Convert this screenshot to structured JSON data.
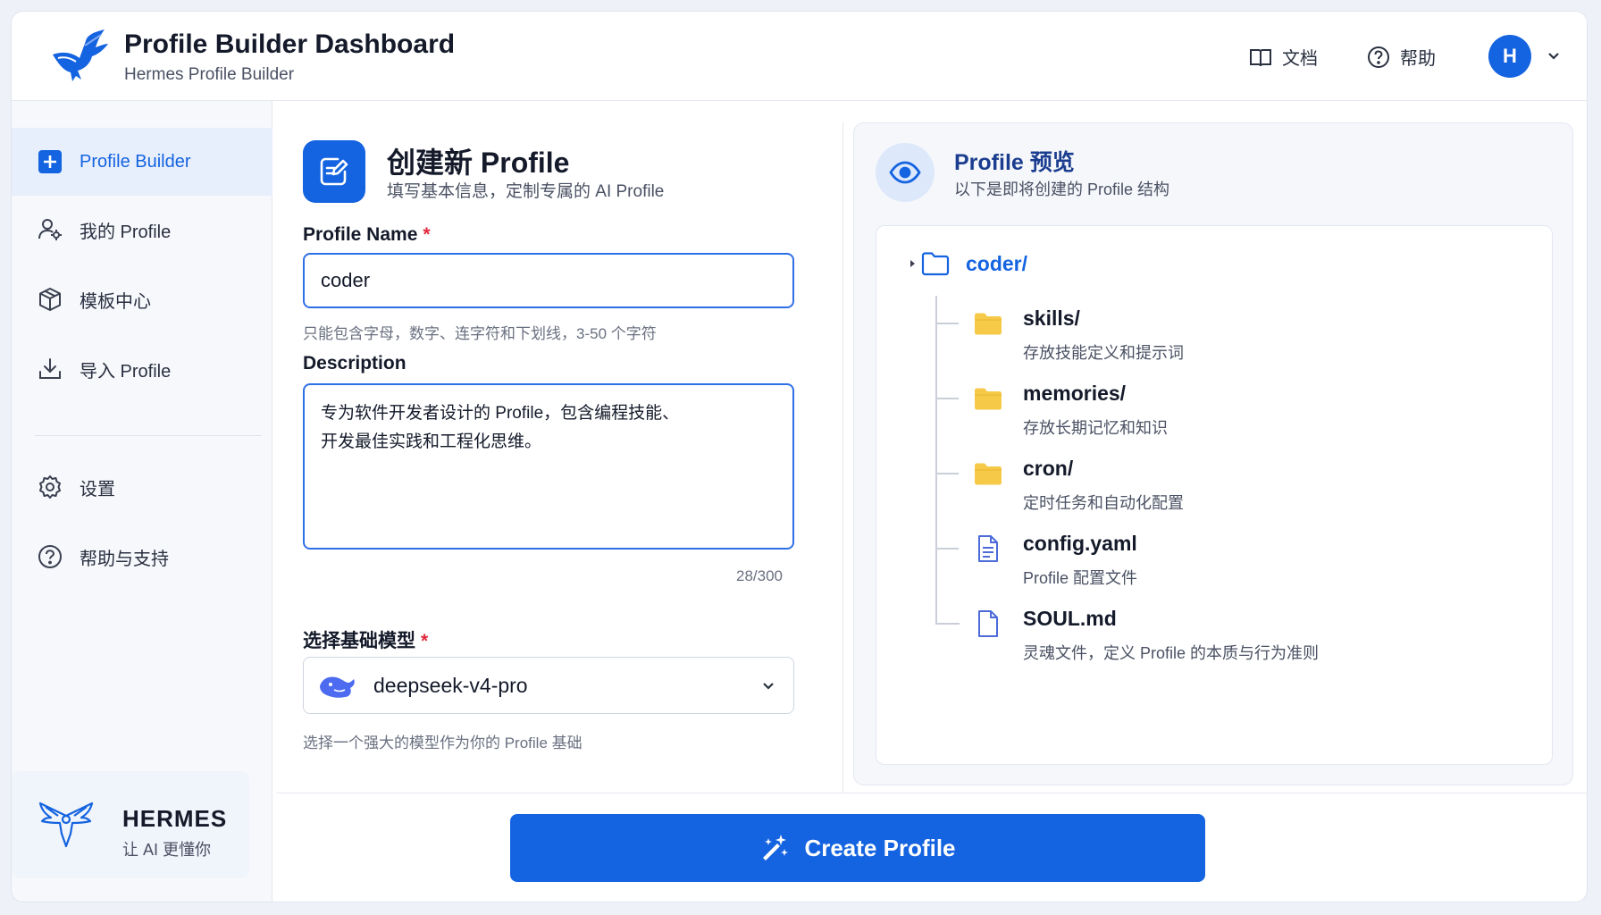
{
  "header": {
    "title": "Profile Builder Dashboard",
    "subtitle": "Hermes Profile Builder",
    "docs_label": "文档",
    "help_label": "帮助",
    "avatar_initial": "H"
  },
  "sidebar": {
    "items": [
      {
        "label": "Profile Builder",
        "icon": "plus-square-icon",
        "active": true
      },
      {
        "label": "我的 Profile",
        "icon": "users-icon"
      },
      {
        "label": "模板中心",
        "icon": "cube-icon"
      },
      {
        "label": "导入 Profile",
        "icon": "import-icon"
      },
      {
        "label": "设置",
        "icon": "gear-icon"
      },
      {
        "label": "帮助与支持",
        "icon": "help-circle-icon"
      }
    ],
    "brand": {
      "name": "HERMES",
      "tagline": "让 AI 更懂你"
    }
  },
  "form": {
    "title": "创建新 Profile",
    "subtitle": "填写基本信息，定制专属的 AI Profile",
    "name_label": "Profile Name",
    "name_value": "coder",
    "name_hint": "只能包含字母，数字、连字符和下划线，3-50 个字符",
    "desc_label": "Description",
    "desc_value": "专为软件开发者设计的 Profile，包含编程技能、\n开发最佳实践和工程化思维。",
    "desc_counter": "28/300",
    "model_label": "选择基础模型",
    "model_value": "deepseek-v4-pro",
    "model_hint": "选择一个强大的模型作为你的 Profile 基础",
    "required_mark": "*"
  },
  "preview": {
    "title": "Profile 预览",
    "subtitle": "以下是即将创建的 Profile 结构",
    "root": "coder/",
    "nodes": [
      {
        "name": "skills/",
        "desc": "存放技能定义和提示词",
        "icon": "folder-icon"
      },
      {
        "name": "memories/",
        "desc": "存放长期记忆和知识",
        "icon": "folder-icon"
      },
      {
        "name": "cron/",
        "desc": "定时任务和自动化配置",
        "icon": "folder-icon"
      },
      {
        "name": "config.yaml",
        "desc": "Profile 配置文件",
        "icon": "file-text-icon"
      },
      {
        "name": "SOUL.md",
        "desc": "灵魂文件，定义 Profile 的本质与行为准则",
        "icon": "file-icon"
      }
    ]
  },
  "actions": {
    "create_label": "Create Profile"
  },
  "colors": {
    "primary": "#1463e0",
    "folder": "#f7c948",
    "required": "#e0283c"
  }
}
